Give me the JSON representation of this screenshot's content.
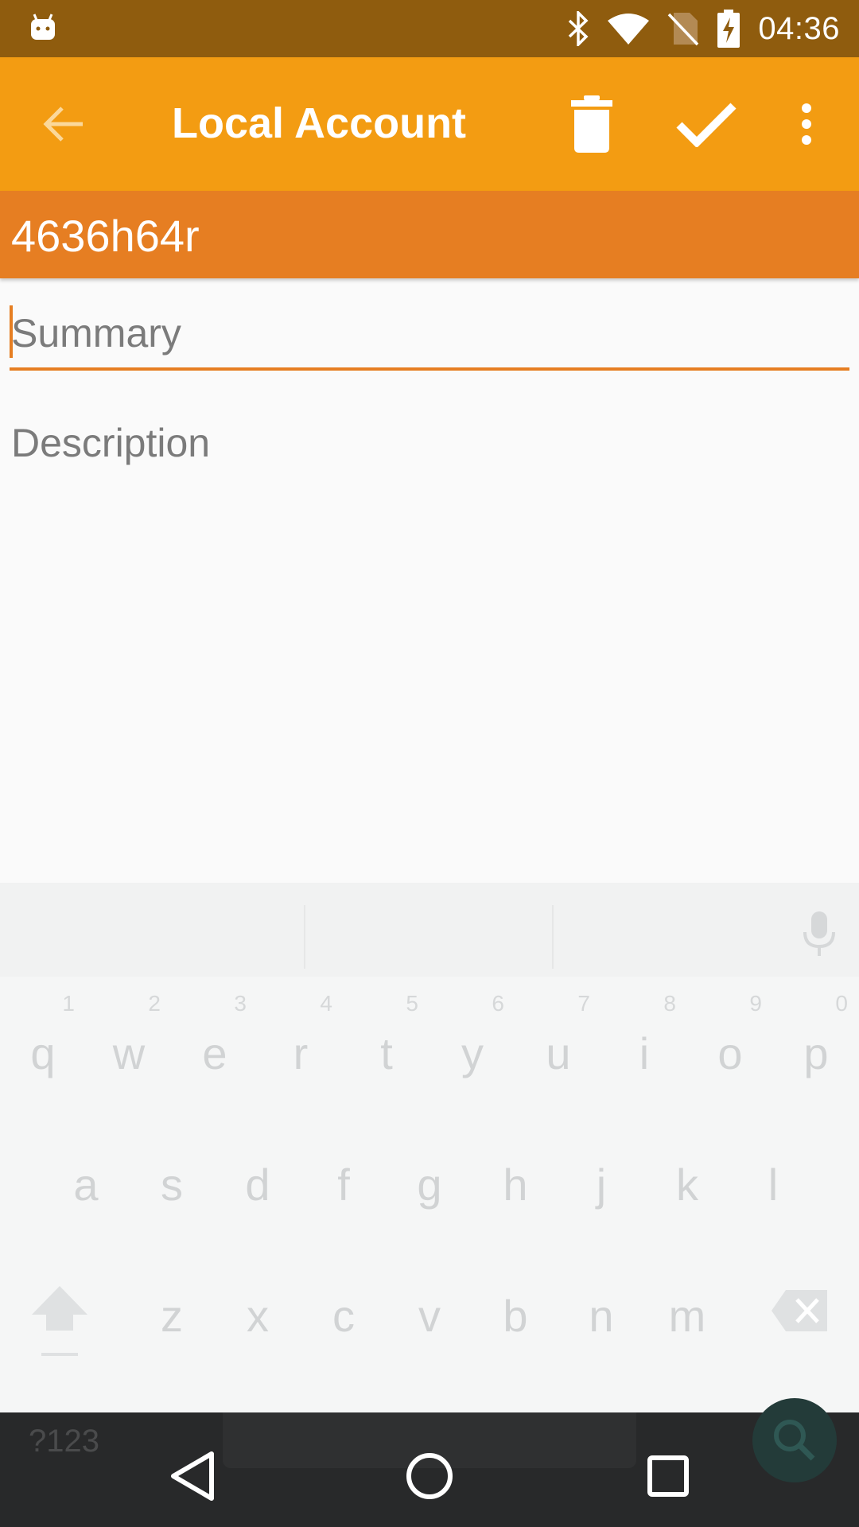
{
  "status_bar": {
    "time": "04:36",
    "icons": [
      "android-debug-icon",
      "bluetooth-icon",
      "wifi-icon",
      "no-sim-icon",
      "battery-charging-icon"
    ]
  },
  "toolbar": {
    "title": "Local Account",
    "actions": [
      "back-arrow-icon",
      "delete-icon",
      "check-icon",
      "more-vert-icon"
    ]
  },
  "account": {
    "name": "4636h64r"
  },
  "form": {
    "summary_placeholder": "Summary",
    "description_placeholder": "Description"
  },
  "keyboard": {
    "row1": [
      {
        "key": "q",
        "hint": "1"
      },
      {
        "key": "w",
        "hint": "2"
      },
      {
        "key": "e",
        "hint": "3"
      },
      {
        "key": "r",
        "hint": "4"
      },
      {
        "key": "t",
        "hint": "5"
      },
      {
        "key": "y",
        "hint": "6"
      },
      {
        "key": "u",
        "hint": "7"
      },
      {
        "key": "i",
        "hint": "8"
      },
      {
        "key": "o",
        "hint": "9"
      },
      {
        "key": "p",
        "hint": "0"
      }
    ],
    "row2": [
      "a",
      "s",
      "d",
      "f",
      "g",
      "h",
      "j",
      "k",
      "l"
    ],
    "row3": [
      "z",
      "x",
      "c",
      "v",
      "b",
      "n",
      "m"
    ],
    "symbols_key": "?123",
    "colors": {
      "key_text": "#d1d3d4",
      "accent": "#e67e22"
    }
  },
  "colors": {
    "status_bar": "#8f5c0e",
    "toolbar": "#f39c12",
    "account_bar": "#e67e22",
    "nav_bar": "#28292a"
  }
}
